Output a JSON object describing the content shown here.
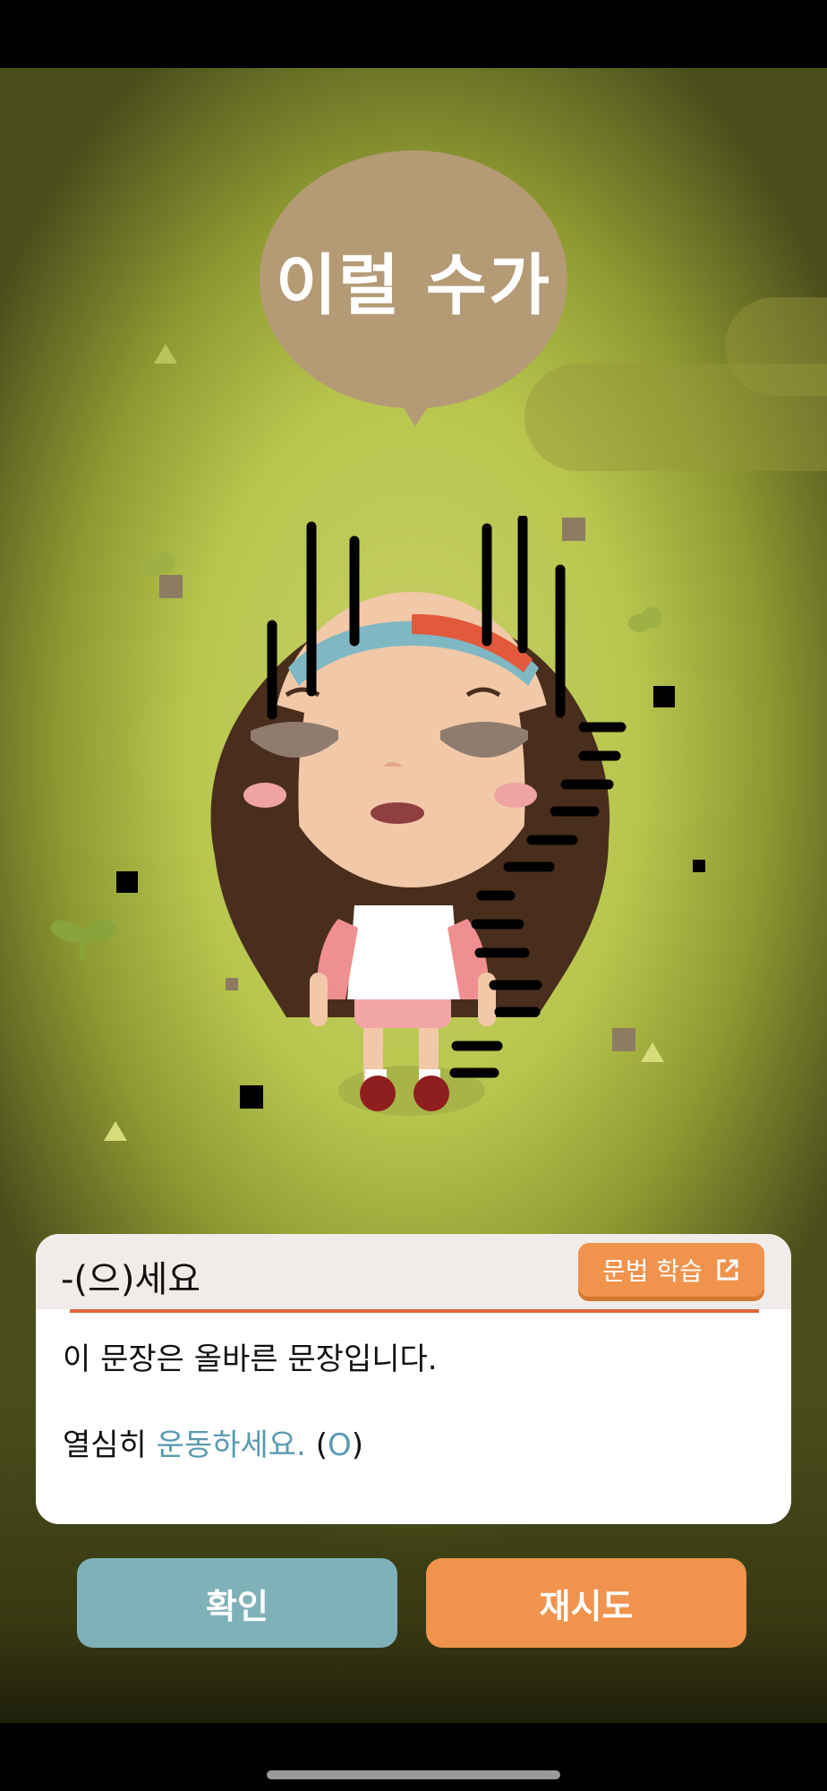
{
  "speech_bubble": {
    "text": "이럴 수가"
  },
  "feedback_card": {
    "title": "-(으)세요",
    "grammar_button": {
      "label": "문법 학습",
      "icon": "external-link-icon"
    },
    "result_text": "이 문장은 올바른 문장입니다.",
    "sentence": {
      "prefix": "열심히",
      "highlight": "운동하세요.",
      "mark_open": "(",
      "mark": "O",
      "mark_close": ")"
    }
  },
  "buttons": {
    "confirm": "확인",
    "retry": "재시도"
  },
  "colors": {
    "accent_orange": "#f0934c",
    "accent_teal": "#7fb1b9",
    "highlight_blue": "#5b9ab0",
    "bubble_brown": "#b59a76"
  }
}
